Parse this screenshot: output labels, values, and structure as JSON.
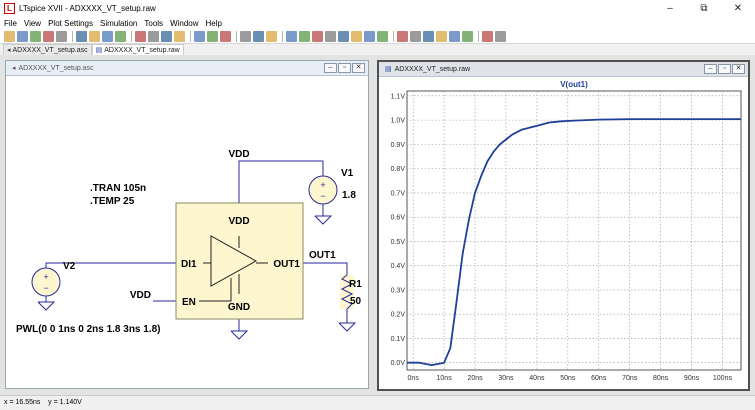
{
  "titlebar": {
    "title": "LTspice XVII - ADXXXX_VT_setup.raw",
    "minimize": "–",
    "maximize": "⧉",
    "close": "✕"
  },
  "menu": [
    "File",
    "View",
    "Plot Settings",
    "Simulation",
    "Tools",
    "Window",
    "Help"
  ],
  "toolbar": {
    "icons": [
      "new-icon",
      "open-icon",
      "save-icon",
      "control-panel-icon",
      "run-icon",
      "halt-icon",
      "zoom-in-icon",
      "pan-icon",
      "zoom-out-icon",
      "zoom-fit-icon",
      "tile-vertical-icon",
      "tile-horizontal-icon",
      "cascade-icon",
      "cut-icon",
      "copy-icon",
      "paste-icon",
      "find-icon",
      "print-icon",
      "print-preview-icon",
      "pencil-icon",
      "ground-icon",
      "label-icon",
      "resistor-icon",
      "capacitor-icon",
      "inductor-icon",
      "diode-icon",
      "component-icon",
      "move-icon",
      "drag-icon",
      "undo-icon",
      "redo-icon",
      "rotate-icon",
      "mirror-icon",
      "text-icon",
      "spice-directive-icon"
    ]
  },
  "tabs": [
    {
      "label": "ADXXXX_VT_setup.asc",
      "icon": "schematic-tab-icon"
    },
    {
      "label": "ADXXXX_VT_setup.raw",
      "icon": "waveform-tab-icon"
    }
  ],
  "schematic": {
    "window_title": "ADXXXX_VT_setup.asc",
    "directives": [
      ".TRAN 105n",
      ".TEMP 25"
    ],
    "components": {
      "v1": {
        "name": "V1",
        "value": "1.8"
      },
      "v2": {
        "name": "V2",
        "value": "PWL(0 0 1ns 0 2ns 1.8 3ns 1.8)"
      },
      "r1": {
        "name": "R1",
        "value": "50"
      },
      "ic": {
        "pins": {
          "vdd": "VDD",
          "in": "DI1",
          "en": "EN",
          "out": "OUT1",
          "gnd": "GND"
        }
      }
    },
    "net_labels": {
      "vdd_top": "VDD",
      "vdd_en": "VDD",
      "out": "OUT1"
    }
  },
  "plot": {
    "window_title": "ADXXXX_VT_setup.raw",
    "trace_label": "V(out1)",
    "trace_color": "#1f3f9a",
    "y_ticks": [
      "0.0V",
      "0.1V",
      "0.2V",
      "0.3V",
      "0.4V",
      "0.5V",
      "0.6V",
      "0.7V",
      "0.8V",
      "0.9V",
      "1.0V",
      "1.1V"
    ],
    "x_ticks": [
      "0ns",
      "10ns",
      "20ns",
      "30ns",
      "40ns",
      "50ns",
      "60ns",
      "70ns",
      "80ns",
      "90ns",
      "100ns"
    ]
  },
  "chart_data": {
    "type": "line",
    "title": "V(out1)",
    "xlabel": "",
    "ylabel": "",
    "xlim": [
      -2,
      106
    ],
    "ylim": [
      -0.03,
      1.12
    ],
    "grid": true,
    "series": [
      {
        "name": "V(out1)",
        "color": "#1f3f9a",
        "x": [
          -2,
          2,
          6,
          10,
          12,
          14,
          16,
          18,
          20,
          22,
          24,
          26,
          28,
          30,
          32,
          35,
          38,
          41,
          44,
          48,
          52,
          56,
          60,
          65,
          70,
          75,
          80,
          90,
          100,
          106
        ],
        "y": [
          0.0,
          0.0,
          -0.01,
          0.0,
          0.06,
          0.25,
          0.45,
          0.59,
          0.7,
          0.77,
          0.83,
          0.87,
          0.9,
          0.92,
          0.94,
          0.96,
          0.97,
          0.98,
          0.99,
          0.995,
          0.998,
          1.0,
          1.002,
          1.003,
          1.004,
          1.004,
          1.004,
          1.004,
          1.004,
          1.004
        ]
      }
    ]
  },
  "status": {
    "x": "x = 16.55ns",
    "y": "y = 1.140V"
  }
}
